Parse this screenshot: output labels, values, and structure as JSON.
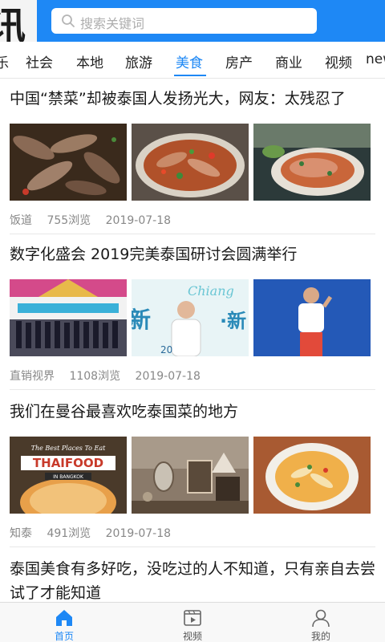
{
  "header": {
    "logo_text": "讯",
    "search_placeholder": "搜索关键词"
  },
  "tabs": [
    {
      "label": "乐",
      "active": false
    },
    {
      "label": "社会",
      "active": false
    },
    {
      "label": "本地",
      "active": false
    },
    {
      "label": "旅游",
      "active": false
    },
    {
      "label": "美食",
      "active": true
    },
    {
      "label": "房产",
      "active": false
    },
    {
      "label": "商业",
      "active": false
    },
    {
      "label": "视频",
      "active": false
    },
    {
      "label": "new",
      "active": false
    }
  ],
  "articles": [
    {
      "title": "中国“禁菜”却被泰国人发扬光大，网友：太残忍了",
      "source": "饭道",
      "views": "755浏览",
      "date": "2019-07-18"
    },
    {
      "title": "数字化盛会 2019完美泰国研讨会圆满举行",
      "source": "直销视界",
      "views": "1108浏览",
      "date": "2019-07-18"
    },
    {
      "title": "我们在曼谷最喜欢吃泰国菜的地方",
      "source": "知泰",
      "views": "491浏览",
      "date": "2019-07-18",
      "image_text": {
        "best_places": "The Best Places To Eat",
        "thai_food": "THAIFOOD",
        "in_bangkok": "IN BANGKOK"
      }
    },
    {
      "title": "泰国美食有多好吃，没吃过的人不知道，只有亲自去尝试了才能知道"
    }
  ],
  "bottom_nav": [
    {
      "label": "首页",
      "icon": "home-icon",
      "active": true
    },
    {
      "label": "视频",
      "icon": "video-icon",
      "active": false
    },
    {
      "label": "我的",
      "icon": "user-icon",
      "active": false
    }
  ],
  "colors": {
    "accent": "#1e88f5",
    "meta_text": "#888888"
  }
}
